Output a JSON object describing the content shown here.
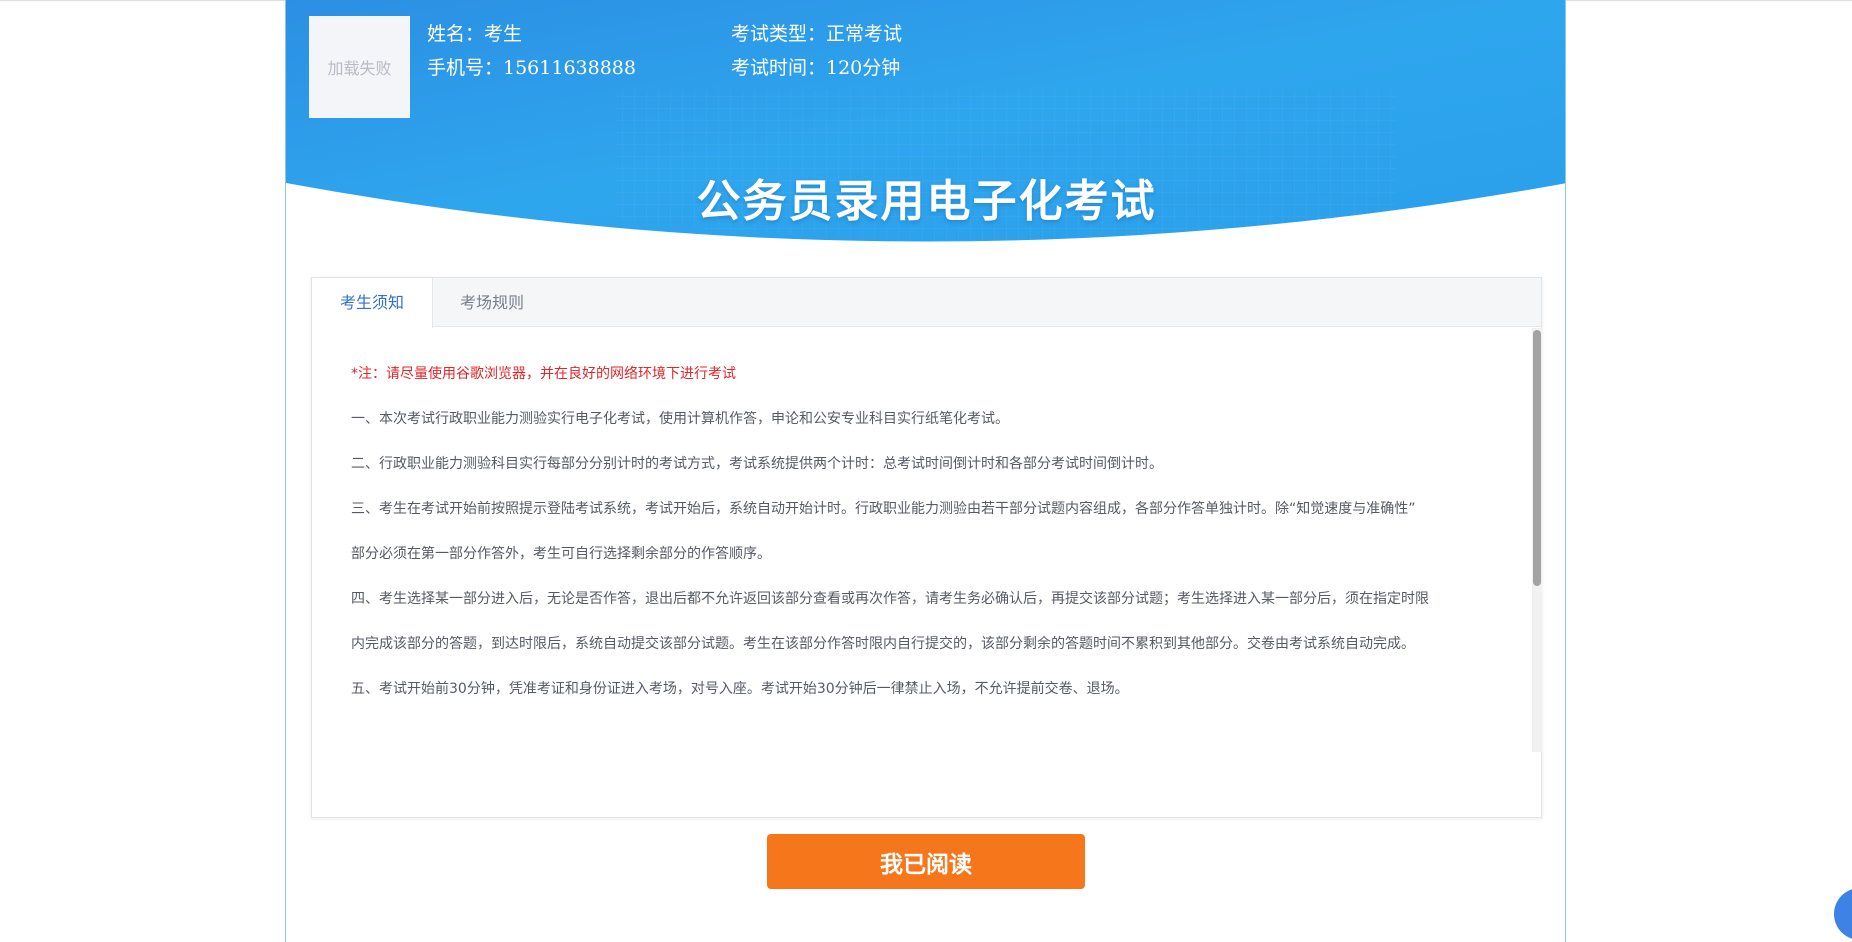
{
  "avatar": {
    "alt_text": "加载失败"
  },
  "candidate": {
    "name": "姓名：考生",
    "phone": "手机号：15611638888",
    "exam_type": "考试类型：正常考试",
    "exam_time": "考试时间：120分钟"
  },
  "exam_title": "公务员录用电子化考试",
  "tabs": [
    {
      "label": "考生须知",
      "active": true
    },
    {
      "label": "考场规则",
      "active": false
    }
  ],
  "notice_lines": [
    "*注：请尽量使用谷歌浏览器，并在良好的网络环境下进行考试",
    "一、本次考试行政职业能力测验实行电子化考试，使用计算机作答，申论和公安专业科目实行纸笔化考试。",
    "二、行政职业能力测验科目实行每部分分别计时的考试方式，考试系统提供两个计时：总考试时间倒计时和各部分考试时间倒计时。",
    "三、考生在考试开始前按照提示登陆考试系统，考试开始后，系统自动开始计时。行政职业能力测验由若干部分试题内容组成，各部分作答单独计时。除“知觉速度与准确性”",
    "部分必须在第一部分作答外，考生可自行选择剩余部分的作答顺序。",
    "四、考生选择某一部分进入后，无论是否作答，退出后都不允许返回该部分查看或再次作答，请考生务必确认后，再提交该部分试题；考生选择进入某一部分后，须在指定时限",
    "内完成该部分的答题，到达时限后，系统自动提交该部分试题。考生在该部分作答时限内自行提交的，该部分剩余的答题时间不累积到其他部分。交卷由考试系统自动完成。",
    "五、考试开始前30分钟，凭准考证和身份证进入考场，对号入座。考试开始30分钟后一律禁止入场，不允许提前交卷、退场。"
  ],
  "read_button": {
    "label": "我已阅读"
  },
  "colors": {
    "header_blue": "#2a9fea",
    "accent_orange": "#f6761c",
    "note_red": "#e0262b",
    "tab_active": "#2f6fd1"
  }
}
